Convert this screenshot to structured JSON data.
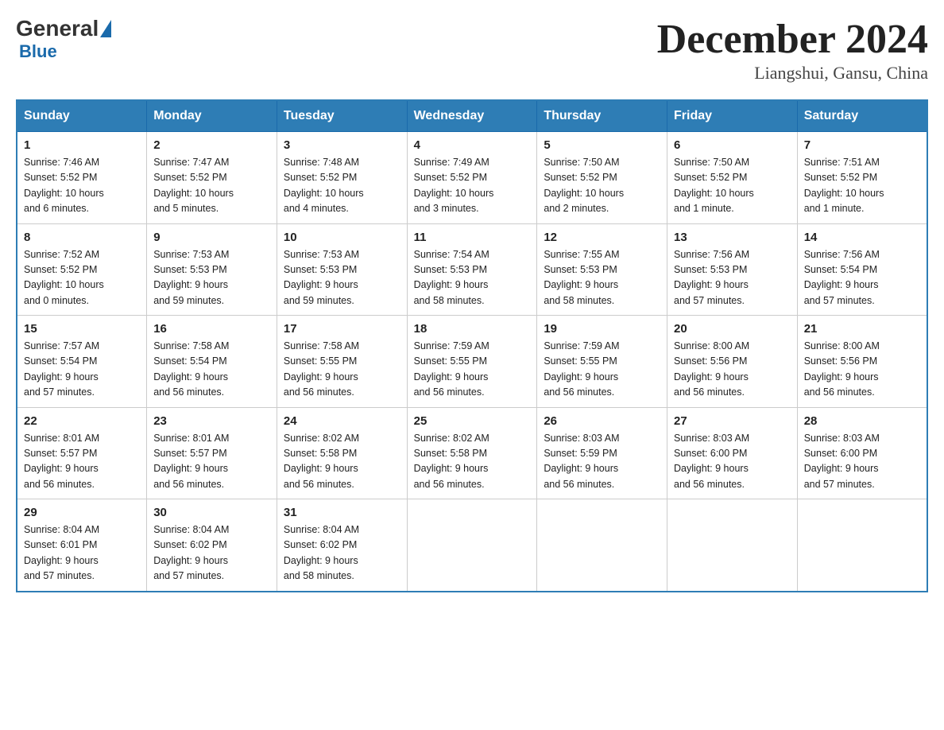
{
  "header": {
    "logo_general": "General",
    "logo_blue": "Blue",
    "main_title": "December 2024",
    "subtitle": "Liangshui, Gansu, China"
  },
  "weekdays": [
    "Sunday",
    "Monday",
    "Tuesday",
    "Wednesday",
    "Thursday",
    "Friday",
    "Saturday"
  ],
  "weeks": [
    [
      {
        "day": "1",
        "info": "Sunrise: 7:46 AM\nSunset: 5:52 PM\nDaylight: 10 hours\nand 6 minutes."
      },
      {
        "day": "2",
        "info": "Sunrise: 7:47 AM\nSunset: 5:52 PM\nDaylight: 10 hours\nand 5 minutes."
      },
      {
        "day": "3",
        "info": "Sunrise: 7:48 AM\nSunset: 5:52 PM\nDaylight: 10 hours\nand 4 minutes."
      },
      {
        "day": "4",
        "info": "Sunrise: 7:49 AM\nSunset: 5:52 PM\nDaylight: 10 hours\nand 3 minutes."
      },
      {
        "day": "5",
        "info": "Sunrise: 7:50 AM\nSunset: 5:52 PM\nDaylight: 10 hours\nand 2 minutes."
      },
      {
        "day": "6",
        "info": "Sunrise: 7:50 AM\nSunset: 5:52 PM\nDaylight: 10 hours\nand 1 minute."
      },
      {
        "day": "7",
        "info": "Sunrise: 7:51 AM\nSunset: 5:52 PM\nDaylight: 10 hours\nand 1 minute."
      }
    ],
    [
      {
        "day": "8",
        "info": "Sunrise: 7:52 AM\nSunset: 5:52 PM\nDaylight: 10 hours\nand 0 minutes."
      },
      {
        "day": "9",
        "info": "Sunrise: 7:53 AM\nSunset: 5:53 PM\nDaylight: 9 hours\nand 59 minutes."
      },
      {
        "day": "10",
        "info": "Sunrise: 7:53 AM\nSunset: 5:53 PM\nDaylight: 9 hours\nand 59 minutes."
      },
      {
        "day": "11",
        "info": "Sunrise: 7:54 AM\nSunset: 5:53 PM\nDaylight: 9 hours\nand 58 minutes."
      },
      {
        "day": "12",
        "info": "Sunrise: 7:55 AM\nSunset: 5:53 PM\nDaylight: 9 hours\nand 58 minutes."
      },
      {
        "day": "13",
        "info": "Sunrise: 7:56 AM\nSunset: 5:53 PM\nDaylight: 9 hours\nand 57 minutes."
      },
      {
        "day": "14",
        "info": "Sunrise: 7:56 AM\nSunset: 5:54 PM\nDaylight: 9 hours\nand 57 minutes."
      }
    ],
    [
      {
        "day": "15",
        "info": "Sunrise: 7:57 AM\nSunset: 5:54 PM\nDaylight: 9 hours\nand 57 minutes."
      },
      {
        "day": "16",
        "info": "Sunrise: 7:58 AM\nSunset: 5:54 PM\nDaylight: 9 hours\nand 56 minutes."
      },
      {
        "day": "17",
        "info": "Sunrise: 7:58 AM\nSunset: 5:55 PM\nDaylight: 9 hours\nand 56 minutes."
      },
      {
        "day": "18",
        "info": "Sunrise: 7:59 AM\nSunset: 5:55 PM\nDaylight: 9 hours\nand 56 minutes."
      },
      {
        "day": "19",
        "info": "Sunrise: 7:59 AM\nSunset: 5:55 PM\nDaylight: 9 hours\nand 56 minutes."
      },
      {
        "day": "20",
        "info": "Sunrise: 8:00 AM\nSunset: 5:56 PM\nDaylight: 9 hours\nand 56 minutes."
      },
      {
        "day": "21",
        "info": "Sunrise: 8:00 AM\nSunset: 5:56 PM\nDaylight: 9 hours\nand 56 minutes."
      }
    ],
    [
      {
        "day": "22",
        "info": "Sunrise: 8:01 AM\nSunset: 5:57 PM\nDaylight: 9 hours\nand 56 minutes."
      },
      {
        "day": "23",
        "info": "Sunrise: 8:01 AM\nSunset: 5:57 PM\nDaylight: 9 hours\nand 56 minutes."
      },
      {
        "day": "24",
        "info": "Sunrise: 8:02 AM\nSunset: 5:58 PM\nDaylight: 9 hours\nand 56 minutes."
      },
      {
        "day": "25",
        "info": "Sunrise: 8:02 AM\nSunset: 5:58 PM\nDaylight: 9 hours\nand 56 minutes."
      },
      {
        "day": "26",
        "info": "Sunrise: 8:03 AM\nSunset: 5:59 PM\nDaylight: 9 hours\nand 56 minutes."
      },
      {
        "day": "27",
        "info": "Sunrise: 8:03 AM\nSunset: 6:00 PM\nDaylight: 9 hours\nand 56 minutes."
      },
      {
        "day": "28",
        "info": "Sunrise: 8:03 AM\nSunset: 6:00 PM\nDaylight: 9 hours\nand 57 minutes."
      }
    ],
    [
      {
        "day": "29",
        "info": "Sunrise: 8:04 AM\nSunset: 6:01 PM\nDaylight: 9 hours\nand 57 minutes."
      },
      {
        "day": "30",
        "info": "Sunrise: 8:04 AM\nSunset: 6:02 PM\nDaylight: 9 hours\nand 57 minutes."
      },
      {
        "day": "31",
        "info": "Sunrise: 8:04 AM\nSunset: 6:02 PM\nDaylight: 9 hours\nand 58 minutes."
      },
      null,
      null,
      null,
      null
    ]
  ]
}
